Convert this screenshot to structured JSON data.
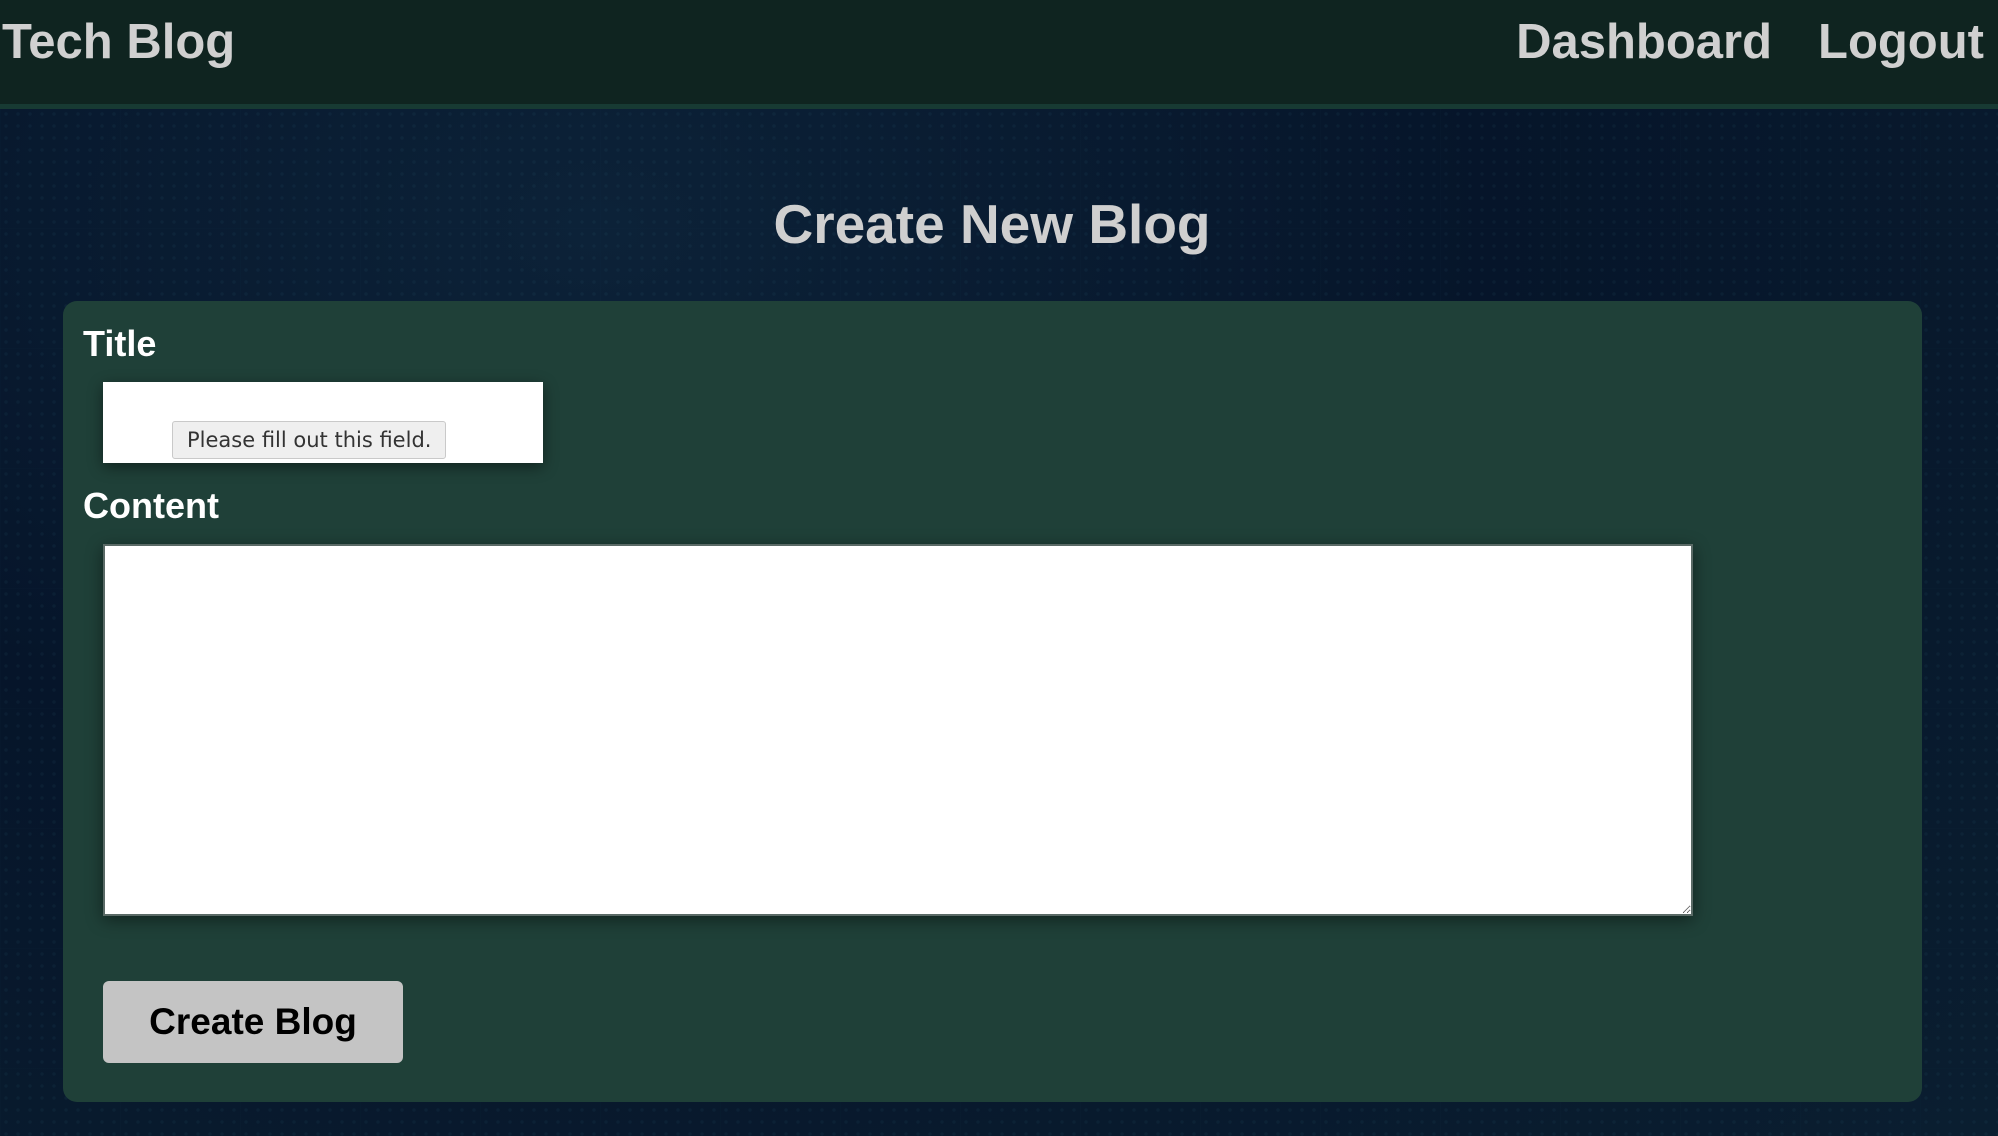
{
  "nav": {
    "brand": "Tech Blog",
    "links": [
      {
        "label": "Dashboard"
      },
      {
        "label": "Logout"
      }
    ]
  },
  "page": {
    "title": "Create New Blog"
  },
  "form": {
    "title_label": "Title",
    "title_value": "",
    "validation_tooltip": "Please fill out this field.",
    "content_label": "Content",
    "content_value": "",
    "submit_label": "Create Blog"
  },
  "colors": {
    "navbar_bg": "#0f2420",
    "card_bg": "#1f4038",
    "button_bg": "#c4c4c4"
  }
}
